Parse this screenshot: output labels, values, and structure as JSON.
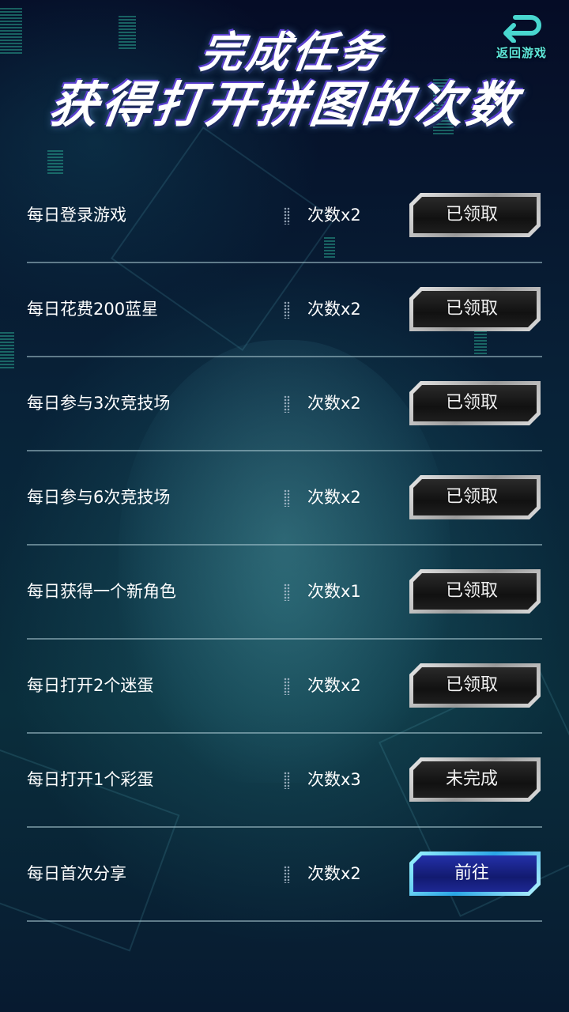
{
  "header": {
    "back_label": "返回游戏",
    "title_line1": "完成任务",
    "title_line2": "获得打开拼图的次数"
  },
  "tasks": [
    {
      "name": "每日登录游戏",
      "reward": "次数x2",
      "button": "已领取",
      "state": "claimed"
    },
    {
      "name": "每日花费200蓝星",
      "reward": "次数x2",
      "button": "已领取",
      "state": "claimed"
    },
    {
      "name": "每日参与3次竞技场",
      "reward": "次数x2",
      "button": "已领取",
      "state": "claimed"
    },
    {
      "name": "每日参与6次竞技场",
      "reward": "次数x2",
      "button": "已领取",
      "state": "claimed"
    },
    {
      "name": "每日获得一个新角色",
      "reward": "次数x1",
      "button": "已领取",
      "state": "claimed"
    },
    {
      "name": "每日打开2个迷蛋",
      "reward": "次数x2",
      "button": "已领取",
      "state": "claimed"
    },
    {
      "name": "每日打开1个彩蛋",
      "reward": "次数x3",
      "button": "未完成",
      "state": "incomplete"
    },
    {
      "name": "每日首次分享",
      "reward": "次数x2",
      "button": "前往",
      "state": "go"
    }
  ],
  "colors": {
    "background": "#06102a",
    "accent_cyan": "#5ee8da",
    "button_blue": "#1d2894",
    "button_gray": "#1e1e1e"
  },
  "icons": {
    "back": "return-arrow-icon"
  }
}
